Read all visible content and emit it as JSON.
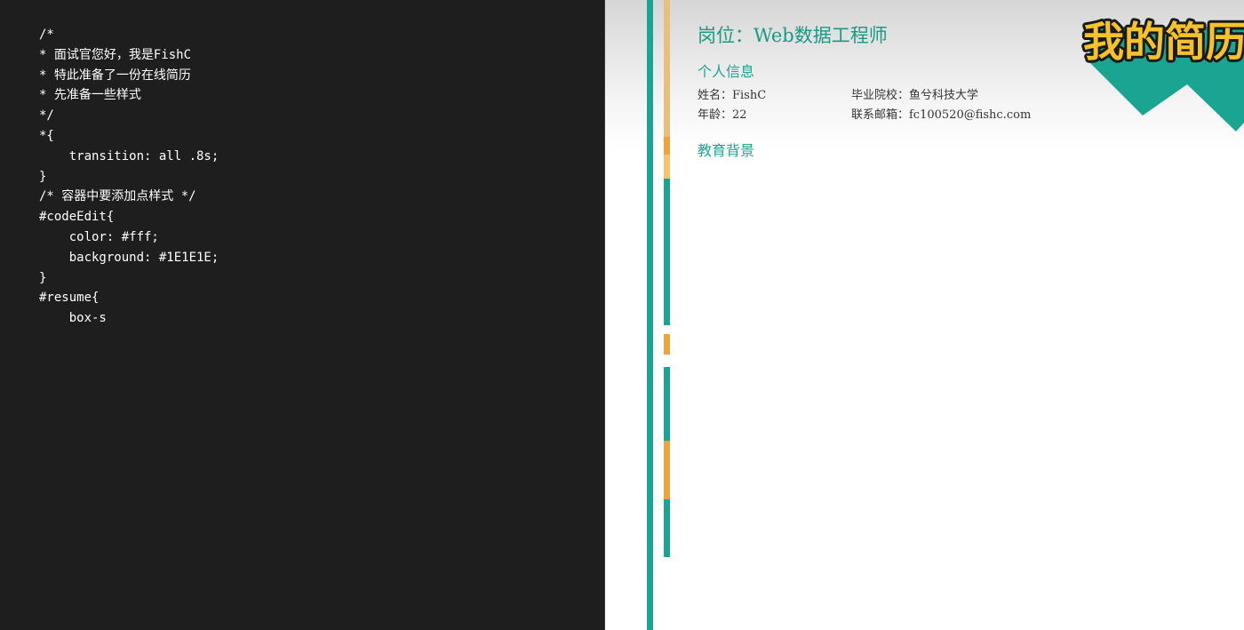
{
  "editor": {
    "background": "#1E1E1E",
    "text_color": "#FFFFFF",
    "code_lines": [
      "/*",
      "* 面试官您好，我是FishC",
      "* 特此准备了一份在线简历",
      "* 先准备一些样式",
      "*/",
      "*{",
      "    transition: all .8s;",
      "}",
      "/* 容器中要添加点样式 */",
      "#codeEdit{",
      "    color: #fff;",
      "    background: #1E1E1E;",
      "}",
      "#resume{",
      "    box-s"
    ]
  },
  "resume": {
    "title": "岗位：Web数据工程师",
    "badge_text": "我的简历",
    "personal": {
      "heading": "个人信息",
      "name": "姓名：FishC",
      "school": "毕业院校：鱼兮科技大学",
      "age": "年龄：22",
      "email": "联系邮箱：fc100520@fishc.com"
    },
    "education": {
      "heading": "教育背景"
    }
  },
  "colors": {
    "accent_teal": "#1AA592",
    "accent_orange": "#EFA43A",
    "badge_yellow": "#F5C229",
    "accent_tan": "#E8C07E"
  }
}
